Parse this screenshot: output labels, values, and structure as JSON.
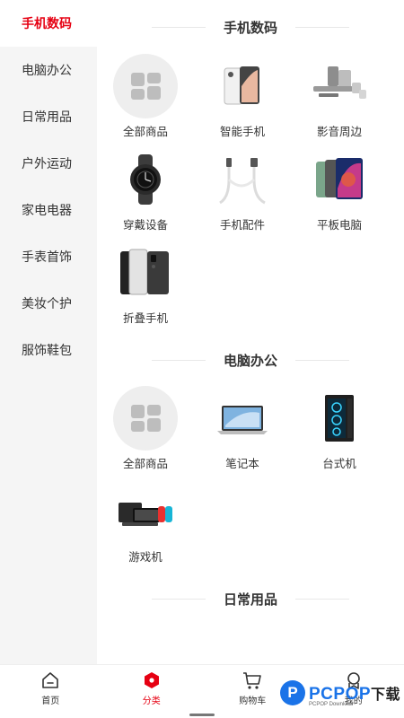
{
  "sidebar": {
    "items": [
      {
        "label": "手机数码",
        "active": true
      },
      {
        "label": "电脑办公"
      },
      {
        "label": "日常用品"
      },
      {
        "label": "户外运动"
      },
      {
        "label": "家电电器"
      },
      {
        "label": "手表首饰"
      },
      {
        "label": "美妆个护"
      },
      {
        "label": "服饰鞋包"
      }
    ]
  },
  "sections": [
    {
      "title": "手机数码",
      "items": [
        {
          "label": "全部商品",
          "icon": "all-products-icon"
        },
        {
          "label": "智能手机",
          "icon": "smartphone-icon"
        },
        {
          "label": "影音周边",
          "icon": "speaker-icon"
        },
        {
          "label": "穿戴设备",
          "icon": "smartwatch-icon"
        },
        {
          "label": "手机配件",
          "icon": "usb-cable-icon"
        },
        {
          "label": "平板电脑",
          "icon": "tablet-icon"
        },
        {
          "label": "折叠手机",
          "icon": "foldable-phone-icon"
        }
      ]
    },
    {
      "title": "电脑办公",
      "items": [
        {
          "label": "全部商品",
          "icon": "all-products-icon"
        },
        {
          "label": "笔记本",
          "icon": "laptop-icon"
        },
        {
          "label": "台式机",
          "icon": "desktop-tower-icon"
        },
        {
          "label": "游戏机",
          "icon": "game-console-icon"
        }
      ]
    },
    {
      "title": "日常用品",
      "items": []
    }
  ],
  "tabbar": {
    "items": [
      {
        "label": "首页",
        "icon": "home-icon"
      },
      {
        "label": "分类",
        "icon": "category-icon",
        "active": true
      },
      {
        "label": "购物车",
        "icon": "cart-icon"
      },
      {
        "label": "我的",
        "icon": "profile-icon"
      }
    ]
  },
  "watermark": {
    "brand": "PCPOP",
    "suffix": "下载",
    "sub": "PCPOP Download"
  },
  "colors": {
    "accent": "#e60012",
    "sidebar_bg": "#f5f5f5",
    "watermark": "#1a73e8"
  }
}
